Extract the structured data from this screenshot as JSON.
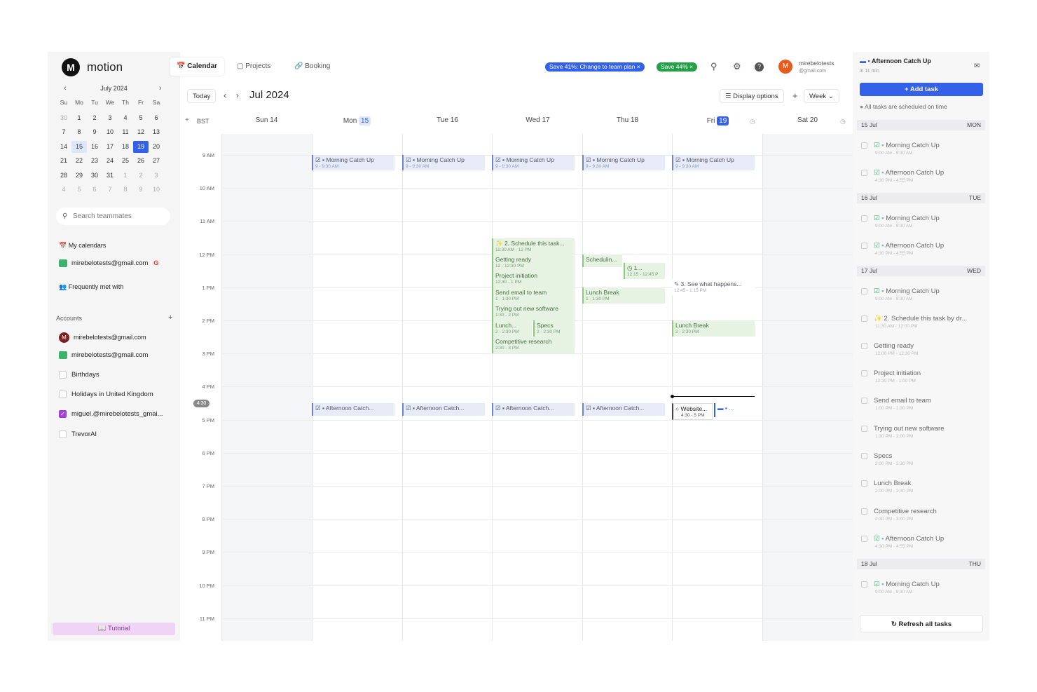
{
  "app": {
    "logo_glyph": "M",
    "name": "motion"
  },
  "mini_calendar": {
    "title": "July 2024",
    "weekday_headers": [
      "Su",
      "Mo",
      "Tu",
      "We",
      "Th",
      "Fr",
      "Sa"
    ],
    "weeks": [
      [
        "30",
        "1",
        "2",
        "3",
        "4",
        "5",
        "6"
      ],
      [
        "7",
        "8",
        "9",
        "10",
        "11",
        "12",
        "13"
      ],
      [
        "14",
        "15",
        "16",
        "17",
        "18",
        "19",
        "20"
      ],
      [
        "21",
        "22",
        "23",
        "24",
        "25",
        "26",
        "27"
      ],
      [
        "28",
        "29",
        "30",
        "31",
        "1",
        "2",
        "3"
      ],
      [
        "4",
        "5",
        "6",
        "7",
        "8",
        "9",
        "10"
      ]
    ]
  },
  "sidebar": {
    "search_placeholder": "Search teammates",
    "my_calendars": "My calendars",
    "my_calendar_account": "mirebelotests@gmail.com",
    "frequently_met": "Frequently met with",
    "accounts": "Accounts",
    "accounts_list": [
      {
        "label": "mirebelotests@gmail.com"
      },
      {
        "label": "mirebelotests@gmail.com"
      },
      {
        "label": "Birthdays"
      },
      {
        "label": "Holidays in United Kingdom"
      },
      {
        "label": "miguel.@mirebelotests_gmai..."
      },
      {
        "label": "TrevorAI"
      }
    ],
    "tutorial": "Tutorial"
  },
  "topnav": {
    "tabs": [
      "Calendar",
      "Projects",
      "Booking"
    ],
    "promo1": "Save 41%: Change to team plan",
    "promo2": "Save 44%",
    "user_name": "mirebelotests",
    "user_email": "@gmail.com",
    "user_initial": "M"
  },
  "calendar": {
    "today_button": "Today",
    "month": "Jul 2024",
    "display_options": "Display options",
    "view": "Week",
    "timezone": "BST",
    "days": [
      {
        "name": "Sun",
        "num": "14"
      },
      {
        "name": "Mon",
        "num": "15"
      },
      {
        "name": "Tue",
        "num": "16"
      },
      {
        "name": "Wed",
        "num": "17"
      },
      {
        "name": "Thu",
        "num": "18"
      },
      {
        "name": "Fri",
        "num": "19"
      },
      {
        "name": "Sat",
        "num": "20"
      }
    ],
    "hours": [
      "9 AM",
      "10 AM",
      "11 AM",
      "12 PM",
      "1 PM",
      "2 PM",
      "3 PM",
      "4 PM",
      "5 PM",
      "6 PM",
      "7 PM",
      "8 PM",
      "9 PM",
      "10 PM",
      "11 PM"
    ],
    "current_time": "4:30",
    "events": {
      "morning": "Morning Catch Up",
      "morning_time": "9 - 9:30 AM",
      "afternoon": "Afternoon Catch...",
      "wed_schedule": "2. Schedule this task...",
      "wed_schedule_time": "11:30 AM - 12 PM",
      "getting_ready": "Getting ready",
      "getting_ready_time": "12 - 12:30 PM",
      "project_init": "Project initiation",
      "project_init_time": "12:30 - 1 PM",
      "send_email": "Send email to team",
      "send_email_time": "1 - 1:30 PM",
      "trying": "Trying out new software",
      "trying_time": "1:30 - 2 PM",
      "lunch_short": "Lunch...",
      "lunch_short_time": "2 - 2:30 PM",
      "specs": "Specs",
      "specs_time": "2 - 2:30 PM",
      "competitive": "Competitive research",
      "competitive_time": "2:30 - 3 PM",
      "thu_scheduling": "Schedulin...",
      "thu_small": "1...",
      "thu_small_time": "12:15 - 12:45 P",
      "lunch_break": "Lunch Break",
      "lunch_break_time": "1 - 1:30 PM",
      "fri_see": "3. See what happens...",
      "fri_see_time": "12:45 - 1:15 PM",
      "fri_lunch": "Lunch Break",
      "fri_lunch_time": "2 - 2:30 PM",
      "website": "Website...",
      "website_time": "4:30 - 5 PM",
      "fri_dots": "..."
    }
  },
  "rightpanel": {
    "current_title": "Afternoon Catch Up",
    "current_sub": "in 11 min",
    "add_task": "Add task",
    "all_scheduled": "All tasks are scheduled on time",
    "refresh": "Refresh all tasks",
    "day1": {
      "date": "15 Jul",
      "dow": "MON"
    },
    "day2": {
      "date": "16 Jul",
      "dow": "TUE"
    },
    "day3": {
      "date": "17 Jul",
      "dow": "WED"
    },
    "day4": {
      "date": "18 Jul",
      "dow": "THU"
    },
    "tasks": [
      {
        "title": "Morning Catch Up",
        "time": "9:00 AM - 9:30 AM"
      },
      {
        "title": "Afternoon Catch Up",
        "time": "4:30 PM - 4:55 PM"
      },
      {
        "title": "Morning Catch Up",
        "time": "9:00 AM - 9:30 AM"
      },
      {
        "title": "Afternoon Catch Up",
        "time": "4:30 PM - 4:55 PM"
      },
      {
        "title": "Morning Catch Up",
        "time": "9:00 AM - 9:30 AM"
      },
      {
        "title": "2. Schedule this task by dr...",
        "time": "11:30 AM - 12:00 PM"
      },
      {
        "title": "Getting ready",
        "time": "12:00 PM - 12:30 PM"
      },
      {
        "title": "Project initiation",
        "time": "12:30 PM - 1:00 PM"
      },
      {
        "title": "Send email to team",
        "time": "1:00 PM - 1:30 PM"
      },
      {
        "title": "Trying out new software",
        "time": "1:30 PM - 2:00 PM"
      },
      {
        "title": "Specs",
        "time": "2:00 PM - 2:30 PM"
      },
      {
        "title": "Lunch Break",
        "time": "2:00 PM - 2:30 PM"
      },
      {
        "title": "Competitive research",
        "time": "2:30 PM - 3:00 PM"
      },
      {
        "title": "Afternoon Catch Up",
        "time": "4:30 PM - 4:55 PM"
      },
      {
        "title": "Morning Catch Up",
        "time": "9:00 AM - 9:30 AM"
      }
    ]
  },
  "colors": {
    "accent": "#3361e8",
    "event_blue": "#e7ebf8",
    "event_green": "#e6f3e3",
    "promo_blue": "#3361e8",
    "promo_green": "#24a148"
  }
}
